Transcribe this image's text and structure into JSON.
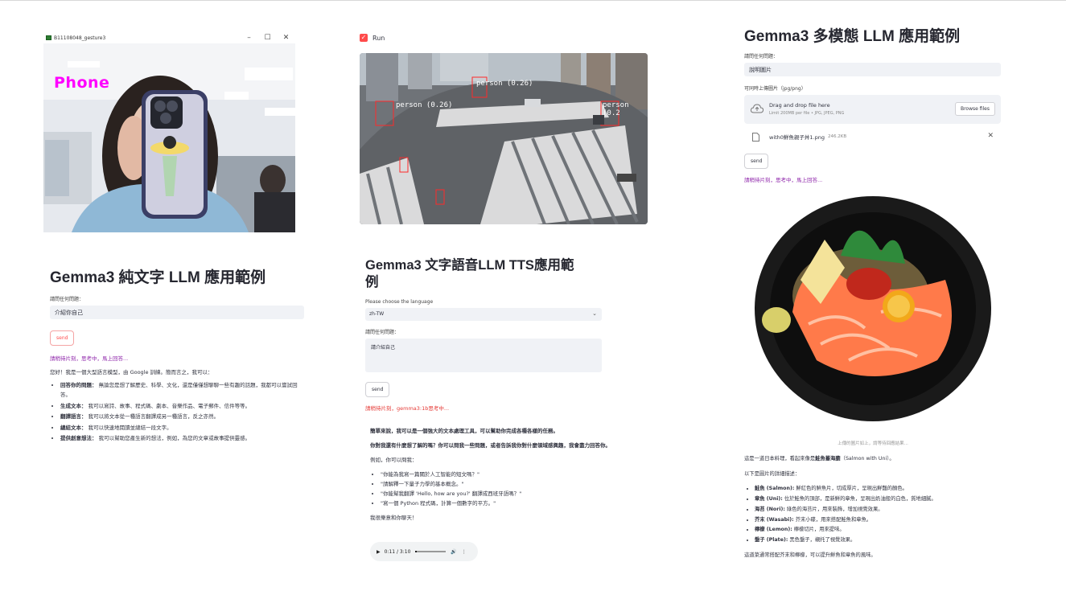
{
  "webcam_window": {
    "title": "B11108048_gesture3",
    "minimize": "–",
    "maximize": "☐",
    "close": "✕",
    "detection_label": "Phone"
  },
  "text_llm": {
    "title": "Gemma3 純文字 LLM 應用範例",
    "question_label": "請問任何問題：",
    "question_value": "介紹你自己",
    "send_label": "send",
    "status": "請稍待片刻，思考中，馬上回答...",
    "intro": "您好！我是一個大型語言模型，由 Google 訓練。簡而言之，我可以：",
    "items": [
      {
        "term": "回答你的問題：",
        "desc": "無論您是想了解歷史、科學、文化，還是僅僅想聊聊一些有趣的話題，我都可以嘗試回答。"
      },
      {
        "term": "生成文本：",
        "desc": "我可以寫詩、故事、程式碼、劇本、音樂作品、電子郵件、信件等等。"
      },
      {
        "term": "翻譯語言：",
        "desc": "我可以將文本從一種語言翻譯成另一種語言，反之亦然。"
      },
      {
        "term": "總結文本：",
        "desc": "我可以快速地閱讀並總結一段文字。"
      },
      {
        "term": "提供創意想法：",
        "desc": "我可以幫助您產生新的想法，例如，為您的文章或故事提供靈感。"
      }
    ]
  },
  "traffic": {
    "run_label": "Run",
    "detections": [
      "person (0.26)",
      "person (0.26)",
      "person (0.2"
    ]
  },
  "tts_llm": {
    "title_line1": "Gemma3 文字語音LLM TTS應用範",
    "title_line2": "例",
    "language_label": "Please choose the language",
    "language_value": "zh-TW",
    "question_label": "請問任何問題：",
    "question_value": "請介紹自己",
    "send_label": "send",
    "status": "請稍待片刻，gemma3:1b思考中...",
    "answer_p1": "簡單來說，我可以是一個強大的文本處理工具，可以幫助你完成各種各樣的任務。",
    "answer_p2": "你對我還有什麼想了解的嗎？你可以問我一些問題，或者告訴我你對什麼領域感興趣，我會盡力回答你。",
    "answer_p3": "例如，你可以問我：",
    "examples": [
      "\"你能為我寫一篇關於人工智能的短文嗎？\"",
      "\"請解釋一下量子力學的基本概念。\"",
      "\"你能幫我翻譯 'Hello, how are you?' 翻譯成西班牙語嗎？\"",
      "\"寫一個 Python 程式碼，計算一個數字的平方。\""
    ],
    "answer_end": "我很樂意和你聊天！",
    "audio_time": "0:11 / 3:10"
  },
  "multimodal_llm": {
    "title": "Gemma3 多模態 LLM 應用範例",
    "question_label": "請問任何問題：",
    "question_value": "說明圖片",
    "upload_label": "可同時上傳圖片（jpg/png）",
    "drop_text": "Drag and drop file here",
    "limit_text": "Limit 200MB per file • JPG, JPEG, PNG",
    "browse_label": "Browse files",
    "file_name": "with0鮮魚親子丼1.png",
    "file_size": "246.2KB",
    "send_label": "send",
    "status": "請稍待片刻，思考中，馬上回答...",
    "caption": "上傳的圖片如上，請等待回應結果...",
    "answer_intro_a": "這是一道日本料理，看起來像是",
    "answer_intro_b": "鮭魚蕃海膽",
    "answer_intro_c": "（Salmon with Uni）。",
    "detail_heading": "以下是圖片的詳細描述：",
    "items": [
      {
        "term": "鮭魚 (Salmon):",
        "desc": "鮮紅色的鮮魚片，切成厚片，呈現出鮮豔的顏色。"
      },
      {
        "term": "章魚 (Uni):",
        "desc": "位於鮭魚的頂部，是新鮮的章魚，呈現出奶油般的白色，質地細膩。"
      },
      {
        "term": "海苔 (Nori):",
        "desc": "綠色的海苔片，用來裝飾，增加視覺效果。"
      },
      {
        "term": "芥末 (Wasabi):",
        "desc": "芥末小碟，用來搭配鮭魚和章魚。"
      },
      {
        "term": "檸檬 (Lemon):",
        "desc": "檸檬切片，用來提味。"
      },
      {
        "term": "盤子 (Plate):",
        "desc": "黑色盤子，襯托了視覺效果。"
      }
    ],
    "answer_end": "這道菜通常搭配芥末和檸檬，可以提升鮮魚和章魚的風味。"
  },
  "colors": {
    "accent": "#ff4b4b",
    "status_purple": "#8e24aa",
    "input_bg": "#f0f2f6",
    "phone_label": "#ff00ff"
  }
}
